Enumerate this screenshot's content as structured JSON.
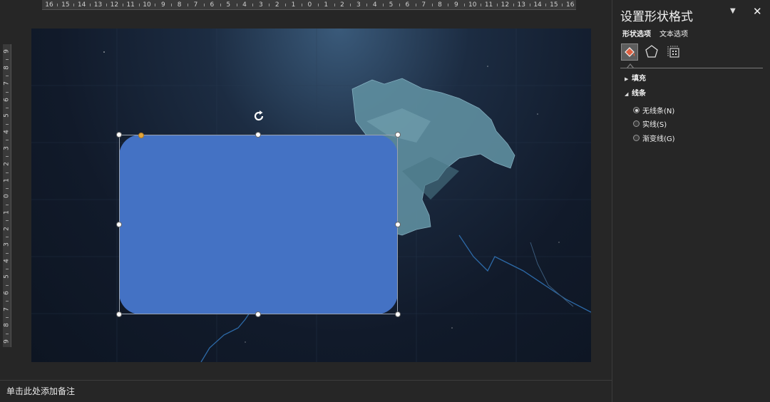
{
  "ruler": {
    "horizontal_labels": [
      "16",
      "15",
      "14",
      "13",
      "12",
      "11",
      "10",
      "9",
      "8",
      "7",
      "6",
      "5",
      "4",
      "3",
      "2",
      "1",
      "0",
      "1",
      "2",
      "3",
      "4",
      "5",
      "6",
      "7",
      "8",
      "9",
      "10",
      "11",
      "12",
      "13",
      "14",
      "15",
      "16"
    ],
    "vertical_labels": [
      "9",
      "8",
      "7",
      "6",
      "5",
      "4",
      "3",
      "2",
      "1",
      "0",
      "1",
      "2",
      "3",
      "4",
      "5",
      "6",
      "7",
      "8",
      "9"
    ]
  },
  "slide": {
    "shape_type": "rounded-rectangle",
    "shape_color": "#4472c4",
    "background_color": "#111a2a",
    "terrain_color": "#5f8fa0",
    "river_color": "#2d6aa8"
  },
  "notes": {
    "placeholder": "单击此处添加备注"
  },
  "pane": {
    "title": "设置形状格式",
    "menu_icon": "dropdown-caret-icon",
    "close_label": "✕",
    "tabs": {
      "shape_options": "形状选项",
      "text_options": "文本选项"
    },
    "categories": {
      "fill_line_icon": "paint-bucket-icon",
      "effects_icon": "pentagon-icon",
      "size_icon": "size-properties-icon"
    },
    "sections": {
      "fill": "填充",
      "line": "线条"
    },
    "line_options": [
      {
        "label": "无线条(N)",
        "selected": true
      },
      {
        "label": "实线(S)",
        "selected": false
      },
      {
        "label": "渐变线(G)",
        "selected": false
      }
    ]
  }
}
